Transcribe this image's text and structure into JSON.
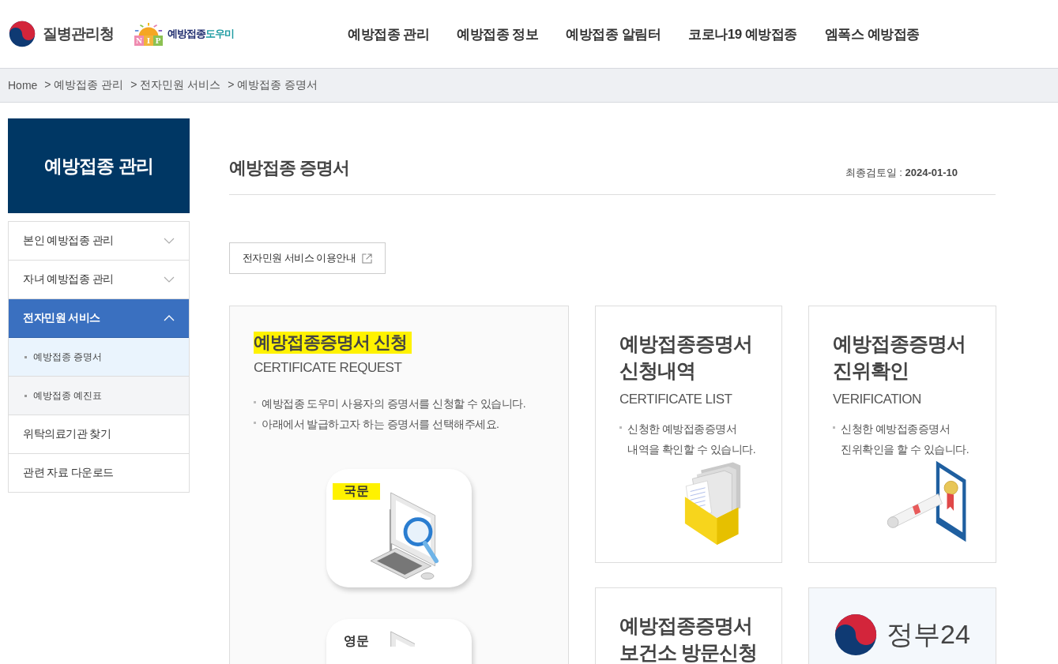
{
  "header": {
    "agency": "질병관리청",
    "nip_letters": [
      "N",
      "I",
      "P"
    ],
    "nip_name": "예방접종",
    "nip_name_accent": "도우미",
    "nav": [
      "예방접종 관리",
      "예방접종 정보",
      "예방접종 알림터",
      "코로나19 예방접종",
      "엠폭스 예방접종"
    ]
  },
  "breadcrumb": [
    "Home",
    "> 예방접종 관리",
    "> 전자민원 서비스",
    "> 예방접종 증명서"
  ],
  "sidebar": {
    "title": "예방접종 관리",
    "items": [
      {
        "label": "본인 예방접종 관리",
        "kind": "menu",
        "expanded": false
      },
      {
        "label": "자녀 예방접종 관리",
        "kind": "menu",
        "expanded": false
      },
      {
        "label": "전자민원 서비스",
        "kind": "menu",
        "expanded": true,
        "children": [
          {
            "label": "예방접종 증명서",
            "selected": true
          },
          {
            "label": "예방접종 예진표",
            "selected": false
          }
        ]
      },
      {
        "label": "위탁의료기관 찾기",
        "kind": "link"
      },
      {
        "label": "관련 자료 다운로드",
        "kind": "link"
      }
    ]
  },
  "page": {
    "title": "예방접종 증명서",
    "review_label": "최종검토일 : ",
    "review_date": "2024-01-10",
    "guide_button": "전자민원 서비스 이용안내"
  },
  "cards": [
    {
      "kind": "request",
      "title": "예방접종증명서 신청",
      "highlighted": true,
      "subtitle": "CERTIFICATE REQUEST",
      "bullets": [
        "예방접종 도우미 사용자의 증명서를 신청할 수 있습니다.",
        "아래에서 발급하고자 하는 증명서를 선택해주세요."
      ],
      "options": [
        {
          "label": "국문",
          "highlighted": true
        },
        {
          "label": "영문",
          "highlighted": false
        }
      ]
    },
    {
      "kind": "list",
      "title": "예방접종증명서\n신청내역",
      "subtitle": "CERTIFICATE LIST",
      "bullets": [
        "신청한 예방접종증명서\n내역을 확인할 수 있습니다."
      ]
    },
    {
      "kind": "verify",
      "title": "예방접종증명서\n진위확인",
      "subtitle": "VERIFICATION",
      "bullets": [
        "신청한 예방접종증명서\n진위확인을 할 수 있습니다."
      ]
    },
    {
      "kind": "visit",
      "title": "예방접종증명서\n보건소 방문신청"
    },
    {
      "kind": "gov24",
      "title": "정부24"
    }
  ]
}
